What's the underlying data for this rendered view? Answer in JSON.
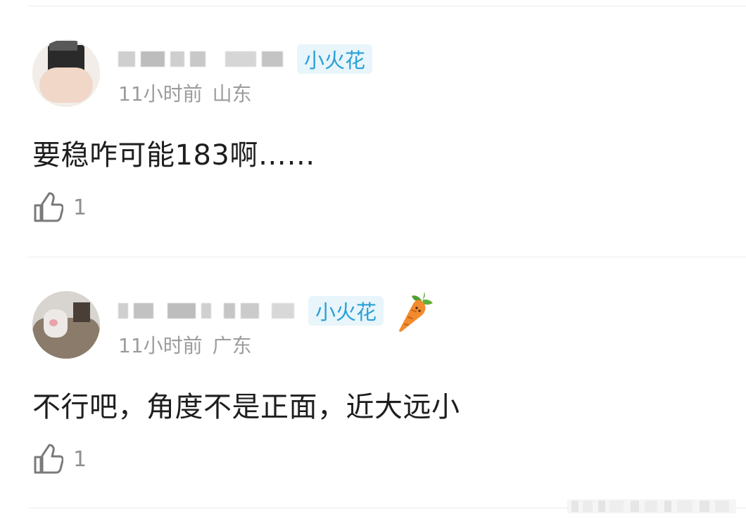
{
  "comments": [
    {
      "badge": "小火花",
      "time": "11小时前",
      "location": "山东",
      "text": "要稳咋可能183啊……",
      "likes": "1"
    },
    {
      "badge": "小火花",
      "time": "11小时前",
      "location": "广东",
      "text": "不行吧，角度不是正面，近大远小",
      "likes": "1",
      "decoration_icon": "carrot-icon"
    }
  ],
  "colors": {
    "badge_text": "#2aa0d6",
    "badge_bg": "#e8f5fb",
    "meta_text": "#9c9c9c",
    "divider": "#ececec"
  }
}
